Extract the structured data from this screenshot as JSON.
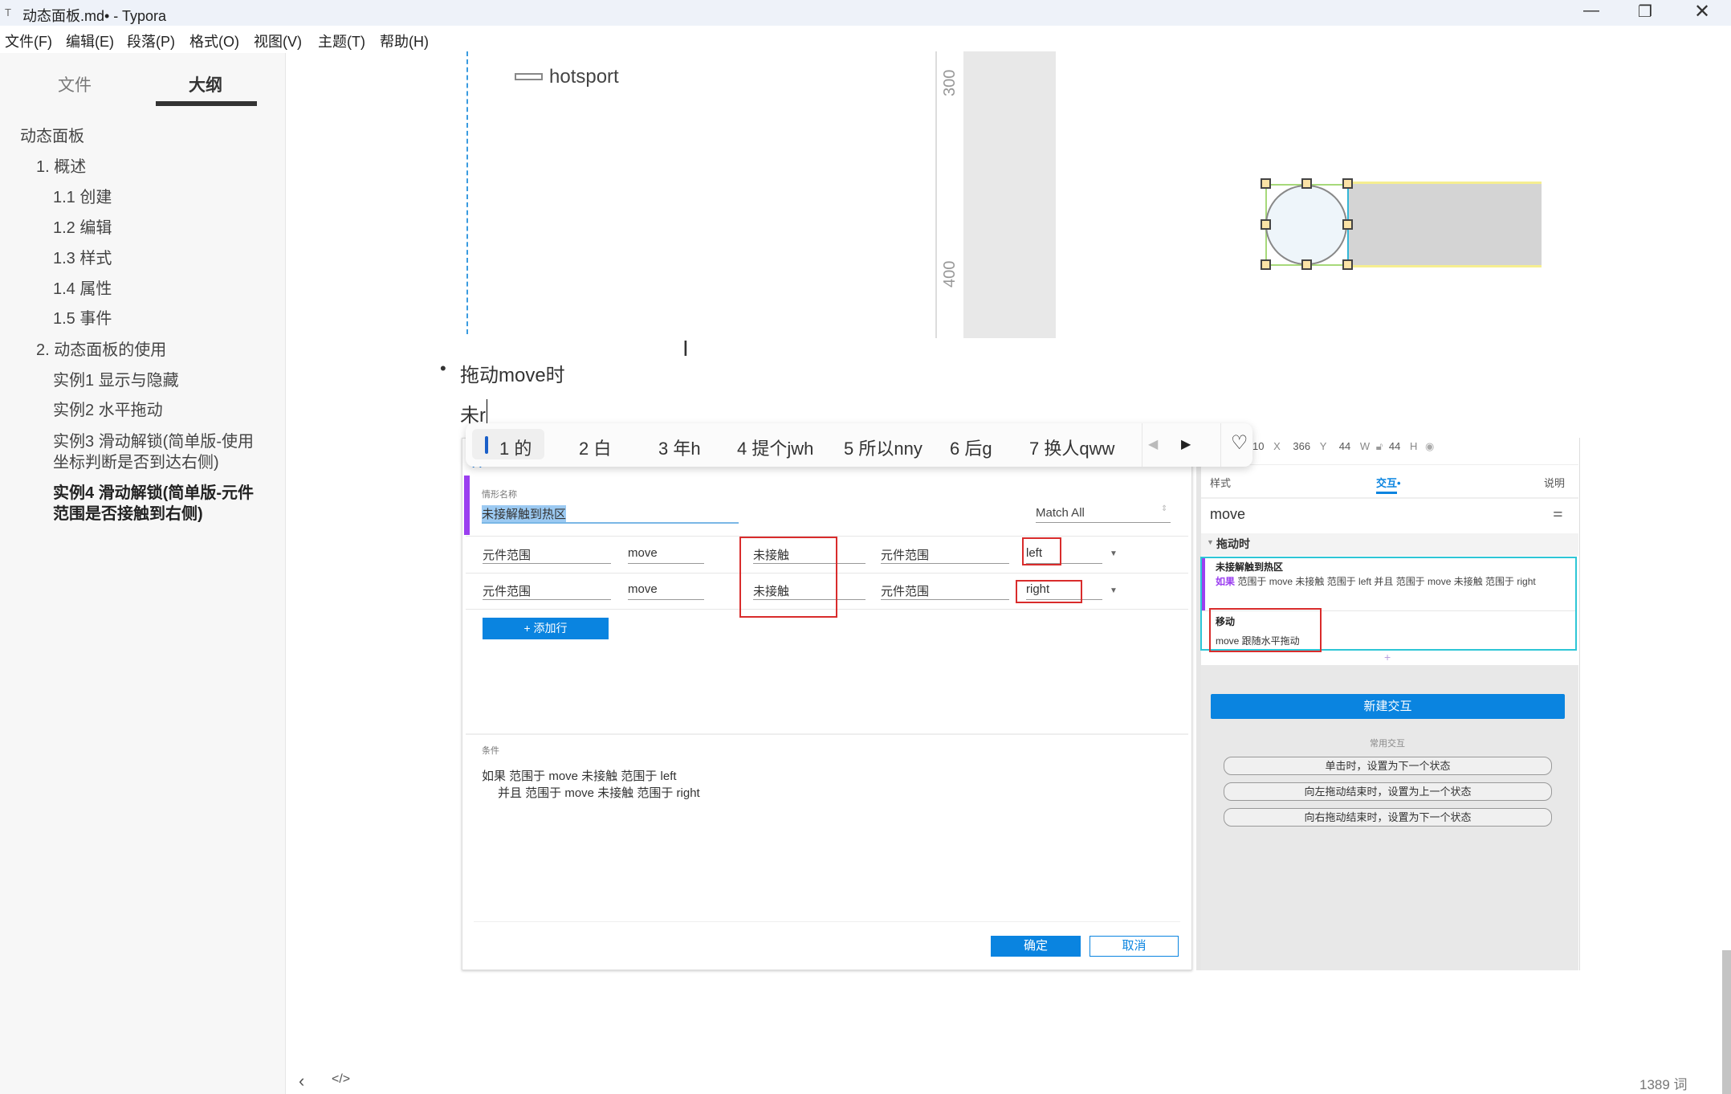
{
  "window": {
    "title": "动态面板.md• - Typora",
    "app_icon": "T"
  },
  "menu": [
    "文件(F)",
    "编辑(E)",
    "段落(P)",
    "格式(O)",
    "视图(V)",
    "主题(T)",
    "帮助(H)"
  ],
  "sidebar": {
    "tabs": [
      "文件",
      "大纲"
    ],
    "active_tab": "大纲",
    "outline": [
      {
        "label": "动态面板",
        "level": 1
      },
      {
        "label": "1. 概述",
        "level": 2
      },
      {
        "label": "1.1 创建",
        "level": 3
      },
      {
        "label": "1.2 编辑",
        "level": 3
      },
      {
        "label": "1.3 样式",
        "level": 3
      },
      {
        "label": "1.4 属性",
        "level": 3
      },
      {
        "label": "1.5 事件",
        "level": 3
      },
      {
        "label": "2. 动态面板的使用",
        "level": 2
      },
      {
        "label": "实例1 显示与隐藏",
        "level": 3
      },
      {
        "label": "实例2 水平拖动",
        "level": 3
      },
      {
        "label": "实例3 滑动解锁(简单版-使用坐标判断是否到达右侧)",
        "level": 3
      },
      {
        "label": "实例4 滑动解锁(简单版-元件范围是否接触到右侧)",
        "level": 3,
        "active": true
      }
    ]
  },
  "canvas": {
    "hotspot_label": "hotsport",
    "ruler_300": "300",
    "ruler_400": "400"
  },
  "doc": {
    "bullet": "拖动move时",
    "typing": "未r"
  },
  "ime": {
    "candidates": [
      "1 的",
      "2 白",
      "3 年h",
      "4 提个jwh",
      "5 所以nny",
      "6 后g",
      "7 换人qww"
    ]
  },
  "dialog": {
    "name_label": "情形名称",
    "name_value": "未接解触到热区",
    "match": "Match All",
    "rows": [
      [
        "元件范围",
        "move",
        "未接触",
        "元件范围",
        "left"
      ],
      [
        "元件范围",
        "move",
        "未接触",
        "元件范围",
        "right"
      ]
    ],
    "add_row": "+ 添加行",
    "cond_label": "条件",
    "cond_line1": "如果 范围于 move 未接触 范围于 left",
    "cond_line2": "并且 范围于 move 未接触 范围于 right",
    "ok": "确定",
    "cancel": "取消"
  },
  "panel": {
    "coords": {
      "x": "10",
      "x_label": "X",
      "y": "366",
      "y_label": "Y",
      "w": "44",
      "w_label": "W",
      "h": "44",
      "h_label": "H"
    },
    "tabs": [
      "样式",
      "交互•",
      "说明"
    ],
    "name": "move",
    "section": "拖动时",
    "case_title": "未接解触到热区",
    "case_if": "如果",
    "case_text": "范围于 move 未接触  范围于 left 并且  范围于 move 未接触  范围于 right",
    "action_title": "移动",
    "action_text": "move 跟随水平拖动",
    "plus": "+",
    "new_btn": "新建交互",
    "common_label": "常用交互",
    "common": [
      "单击时，设置为下一个状态",
      "向左拖动结束时，设置为上一个状态",
      "向右拖动结束时，设置为下一个状态"
    ]
  },
  "status": {
    "word_count": "1389 词"
  },
  "colors": {
    "accent": "#0a84e0",
    "purple": "#9b3ff0",
    "red": "#d92c2c",
    "cyan": "#2ec6d6"
  }
}
